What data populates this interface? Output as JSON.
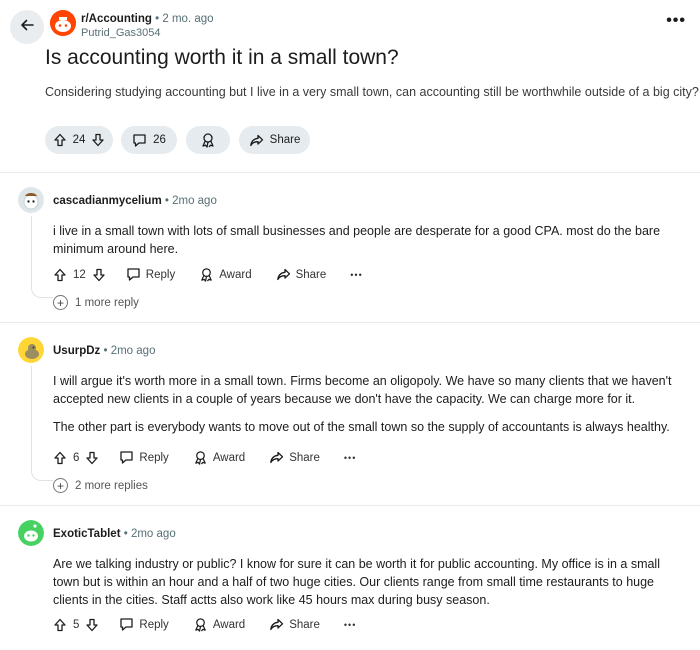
{
  "post": {
    "subreddit": "r/Accounting",
    "separator": "•",
    "age": "2 mo. ago",
    "author": "Putrid_Gas3054",
    "title": "Is accounting worth it in a small town?",
    "body": "Considering studying accounting but I live in a very small town, can accounting still be worthwhile outside of a big city?",
    "upvotes": "24",
    "comments": "26",
    "share_label": "Share",
    "more": "•••"
  },
  "comments": [
    {
      "user": "cascadianmycelium",
      "meta": "• 2mo ago",
      "paragraphs": [
        "i live in a small town with lots of small businesses and people are desperate for a good CPA. most do the bare minimum around here."
      ],
      "score": "12",
      "reply_label": "Reply",
      "award_label": "Award",
      "share_label": "Share",
      "more": "•••",
      "more_replies": "1 more reply"
    },
    {
      "user": "UsurpDz",
      "meta": "• 2mo ago",
      "paragraphs": [
        "I will argue it's worth more in a small town. Firms become an oligopoly. We have so many clients that we haven't accepted new clients in a couple of years because we don't have the capacity. We can charge more for it.",
        "The other part is everybody wants to move out of the small town so the supply of accountants is always healthy."
      ],
      "score": "6",
      "reply_label": "Reply",
      "award_label": "Award",
      "share_label": "Share",
      "more": "•••",
      "more_replies": "2 more replies"
    },
    {
      "user": "ExoticTablet",
      "meta": "• 2mo ago",
      "paragraphs": [
        "Are we talking industry or public? I know for sure it can be worth it for public accounting. My office is in a small town but is within an hour and a half of two huge cities. Our clients range from small time restaurants to huge clients in the cities. Staff actts also work like 45 hours max during busy season."
      ],
      "score": "5",
      "reply_label": "Reply",
      "award_label": "Award",
      "share_label": "Share",
      "more": "•••"
    }
  ],
  "icons": {
    "back": "arrow-left-icon",
    "upvote": "arrow-up-icon",
    "downvote": "arrow-down-icon",
    "comment": "speech-bubble-icon",
    "award": "award-icon",
    "share": "share-arrow-icon",
    "expand": "plus-circle-icon"
  },
  "colors": {
    "subreddit_avatar": "#ff4500",
    "avatar_yellow": "#ffd635",
    "avatar_green": "#46d160",
    "pill_bg": "#e5ebee"
  }
}
